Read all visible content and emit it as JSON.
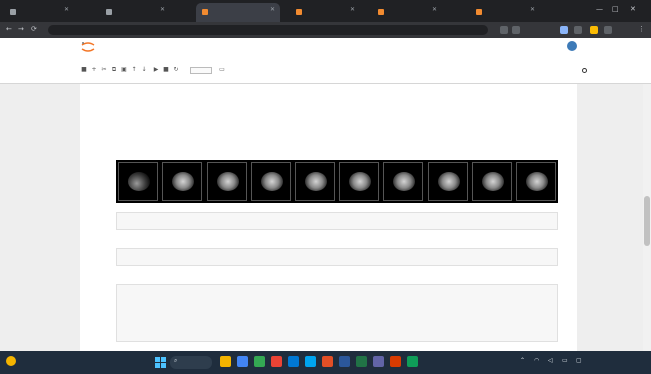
{
  "browser": {
    "tabs": [
      {
        "title": "",
        "favicon_color": "#9aa0a6"
      },
      {
        "title": "",
        "favicon_color": "#9aa0a6"
      },
      {
        "title": "",
        "favicon_color": "#f28b30"
      },
      {
        "title": "",
        "favicon_color": "#f28b30"
      },
      {
        "title": "",
        "favicon_color": "#f28b30"
      },
      {
        "title": "",
        "favicon_color": "#f28b30"
      }
    ],
    "active_tab_color": "#3c3f47",
    "address": ""
  },
  "jupyter": {
    "brand": "",
    "notebook_title": "",
    "trusted": "",
    "menu": [
      "",
      "",
      "",
      "",
      "",
      "",
      ""
    ],
    "kernel": ""
  },
  "notebook": {
    "output_heading": "",
    "stats": [
      "",
      "",
      "",
      "",
      "",
      ""
    ],
    "slice_count": 10,
    "cells": [
      {
        "prompt": "",
        "lines": [
          "",
          ""
        ],
        "output": ""
      },
      {
        "prompt": "",
        "lines": [
          "",
          ""
        ],
        "output": ""
      },
      {
        "prompt": "",
        "lines": [
          "",
          "",
          "",
          "",
          "",
          "",
          ""
        ],
        "output": ""
      }
    ]
  },
  "taskbar": {
    "weather_temp": "",
    "weather_desc": "",
    "search": "",
    "time": "",
    "date": "",
    "apps": [
      {
        "color": "#f4b400"
      },
      {
        "color": "#4285f4"
      },
      {
        "color": "#34a853"
      },
      {
        "color": "#ea4335"
      },
      {
        "color": "#0078d4"
      },
      {
        "color": "#00a4ef"
      },
      {
        "color": "#e34f26"
      },
      {
        "color": "#2b579a"
      },
      {
        "color": "#217346"
      },
      {
        "color": "#6264a7"
      },
      {
        "color": "#d83b01"
      },
      {
        "color": "#0f9d58"
      }
    ]
  }
}
